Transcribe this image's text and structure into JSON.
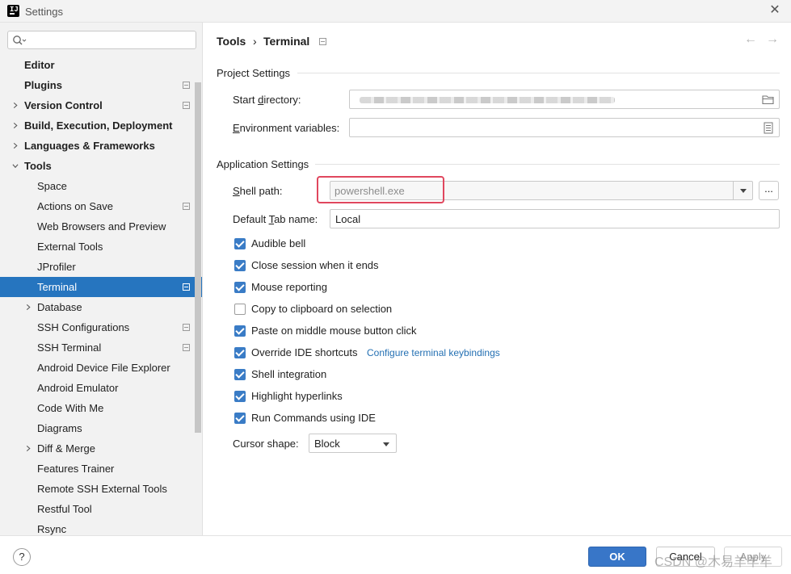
{
  "window": {
    "title": "Settings"
  },
  "search": {
    "placeholder": ""
  },
  "sidebar": {
    "items": [
      {
        "label": "Editor",
        "name": "editor",
        "bold": true,
        "arrow": "none",
        "level": 0,
        "mod": false
      },
      {
        "label": "Plugins",
        "name": "plugins",
        "bold": true,
        "arrow": "none",
        "level": 0,
        "mod": true
      },
      {
        "label": "Version Control",
        "name": "version-control",
        "bold": true,
        "arrow": "right",
        "level": 0,
        "mod": true
      },
      {
        "label": "Build, Execution, Deployment",
        "name": "build-execution-deployment",
        "bold": true,
        "arrow": "right",
        "level": 0,
        "mod": false
      },
      {
        "label": "Languages & Frameworks",
        "name": "languages-frameworks",
        "bold": true,
        "arrow": "right",
        "level": 0,
        "mod": false
      },
      {
        "label": "Tools",
        "name": "tools",
        "bold": true,
        "arrow": "down",
        "level": 0,
        "mod": false
      },
      {
        "label": "Space",
        "name": "space",
        "bold": false,
        "arrow": "none",
        "level": 1,
        "mod": false
      },
      {
        "label": "Actions on Save",
        "name": "actions-on-save",
        "bold": false,
        "arrow": "none",
        "level": 1,
        "mod": true
      },
      {
        "label": "Web Browsers and Preview",
        "name": "web-browsers-preview",
        "bold": false,
        "arrow": "none",
        "level": 1,
        "mod": false
      },
      {
        "label": "External Tools",
        "name": "external-tools",
        "bold": false,
        "arrow": "none",
        "level": 1,
        "mod": false
      },
      {
        "label": "JProfiler",
        "name": "jprofiler",
        "bold": false,
        "arrow": "none",
        "level": 1,
        "mod": false
      },
      {
        "label": "Terminal",
        "name": "terminal",
        "bold": false,
        "arrow": "none",
        "level": 1,
        "mod": true,
        "selected": true
      },
      {
        "label": "Database",
        "name": "database",
        "bold": false,
        "arrow": "right",
        "level": 1,
        "mod": false
      },
      {
        "label": "SSH Configurations",
        "name": "ssh-configurations",
        "bold": false,
        "arrow": "none",
        "level": 1,
        "mod": true
      },
      {
        "label": "SSH Terminal",
        "name": "ssh-terminal",
        "bold": false,
        "arrow": "none",
        "level": 1,
        "mod": true
      },
      {
        "label": "Android Device File Explorer",
        "name": "android-device-file-explorer",
        "bold": false,
        "arrow": "none",
        "level": 1,
        "mod": false
      },
      {
        "label": "Android Emulator",
        "name": "android-emulator",
        "bold": false,
        "arrow": "none",
        "level": 1,
        "mod": false
      },
      {
        "label": "Code With Me",
        "name": "code-with-me",
        "bold": false,
        "arrow": "none",
        "level": 1,
        "mod": false
      },
      {
        "label": "Diagrams",
        "name": "diagrams",
        "bold": false,
        "arrow": "none",
        "level": 1,
        "mod": false
      },
      {
        "label": "Diff & Merge",
        "name": "diff-merge",
        "bold": false,
        "arrow": "right",
        "level": 1,
        "mod": false
      },
      {
        "label": "Features Trainer",
        "name": "features-trainer",
        "bold": false,
        "arrow": "none",
        "level": 1,
        "mod": false
      },
      {
        "label": "Remote SSH External Tools",
        "name": "remote-ssh-external-tools",
        "bold": false,
        "arrow": "none",
        "level": 1,
        "mod": false
      },
      {
        "label": "Restful Tool",
        "name": "restful-tool",
        "bold": false,
        "arrow": "none",
        "level": 1,
        "mod": false
      },
      {
        "label": "Rsync",
        "name": "rsync",
        "bold": false,
        "arrow": "none",
        "level": 1,
        "mod": false
      }
    ]
  },
  "breadcrumb": {
    "parent": "Tools",
    "separator": "›",
    "current": "Terminal",
    "back_icon": "arrow-left-icon",
    "forward_icon": "arrow-right-icon"
  },
  "project_settings": {
    "title": "Project Settings",
    "start_directory": {
      "label_pre": "Start ",
      "label_u": "d",
      "label_post": "irectory:",
      "value": "",
      "icon": "folder-icon"
    },
    "environment_variables": {
      "label_pre": "",
      "label_u": "E",
      "label_post": "nvironment variables:",
      "value": "",
      "icon": "document-icon"
    }
  },
  "application_settings": {
    "title": "Application Settings",
    "shell_path": {
      "label_pre": "",
      "label_u": "S",
      "label_post": "hell path:",
      "placeholder": "powershell.exe",
      "browse_label": "..."
    },
    "default_tab_name": {
      "label_pre": "Default ",
      "label_u": "T",
      "label_post": "ab name:",
      "value": "Local"
    },
    "options": [
      {
        "label": "Audible bell",
        "checked": true,
        "name": "audible-bell"
      },
      {
        "label": "Close session when it ends",
        "checked": true,
        "name": "close-session"
      },
      {
        "label": "Mouse reporting",
        "checked": true,
        "name": "mouse-reporting"
      },
      {
        "label": "Copy to clipboard on selection",
        "checked": false,
        "name": "copy-to-clipboard"
      },
      {
        "label": "Paste on middle mouse button click",
        "checked": true,
        "name": "paste-middle-click"
      },
      {
        "label": "Override IDE shortcuts",
        "checked": true,
        "name": "override-ide-shortcuts"
      },
      {
        "label": "Shell integration",
        "checked": true,
        "name": "shell-integration"
      },
      {
        "label": "Highlight hyperlinks",
        "checked": true,
        "name": "highlight-hyperlinks"
      },
      {
        "label": "Run Commands using IDE",
        "checked": true,
        "name": "run-commands-ide"
      }
    ],
    "configure_link": "Configure terminal keybindings",
    "cursor_shape": {
      "label": "Cursor shape:",
      "value": "Block"
    }
  },
  "footer": {
    "help_label": "?",
    "ok_label": "OK",
    "cancel_label": "Cancel",
    "apply_label": "Apply",
    "watermark": "CSDN @木易羊羊羊"
  },
  "colors": {
    "selection": "#2675bf",
    "ok_button": "#3876c8",
    "checkbox": "#3a7cc6",
    "link": "#2470b3",
    "highlight_border": "#e0475e"
  }
}
